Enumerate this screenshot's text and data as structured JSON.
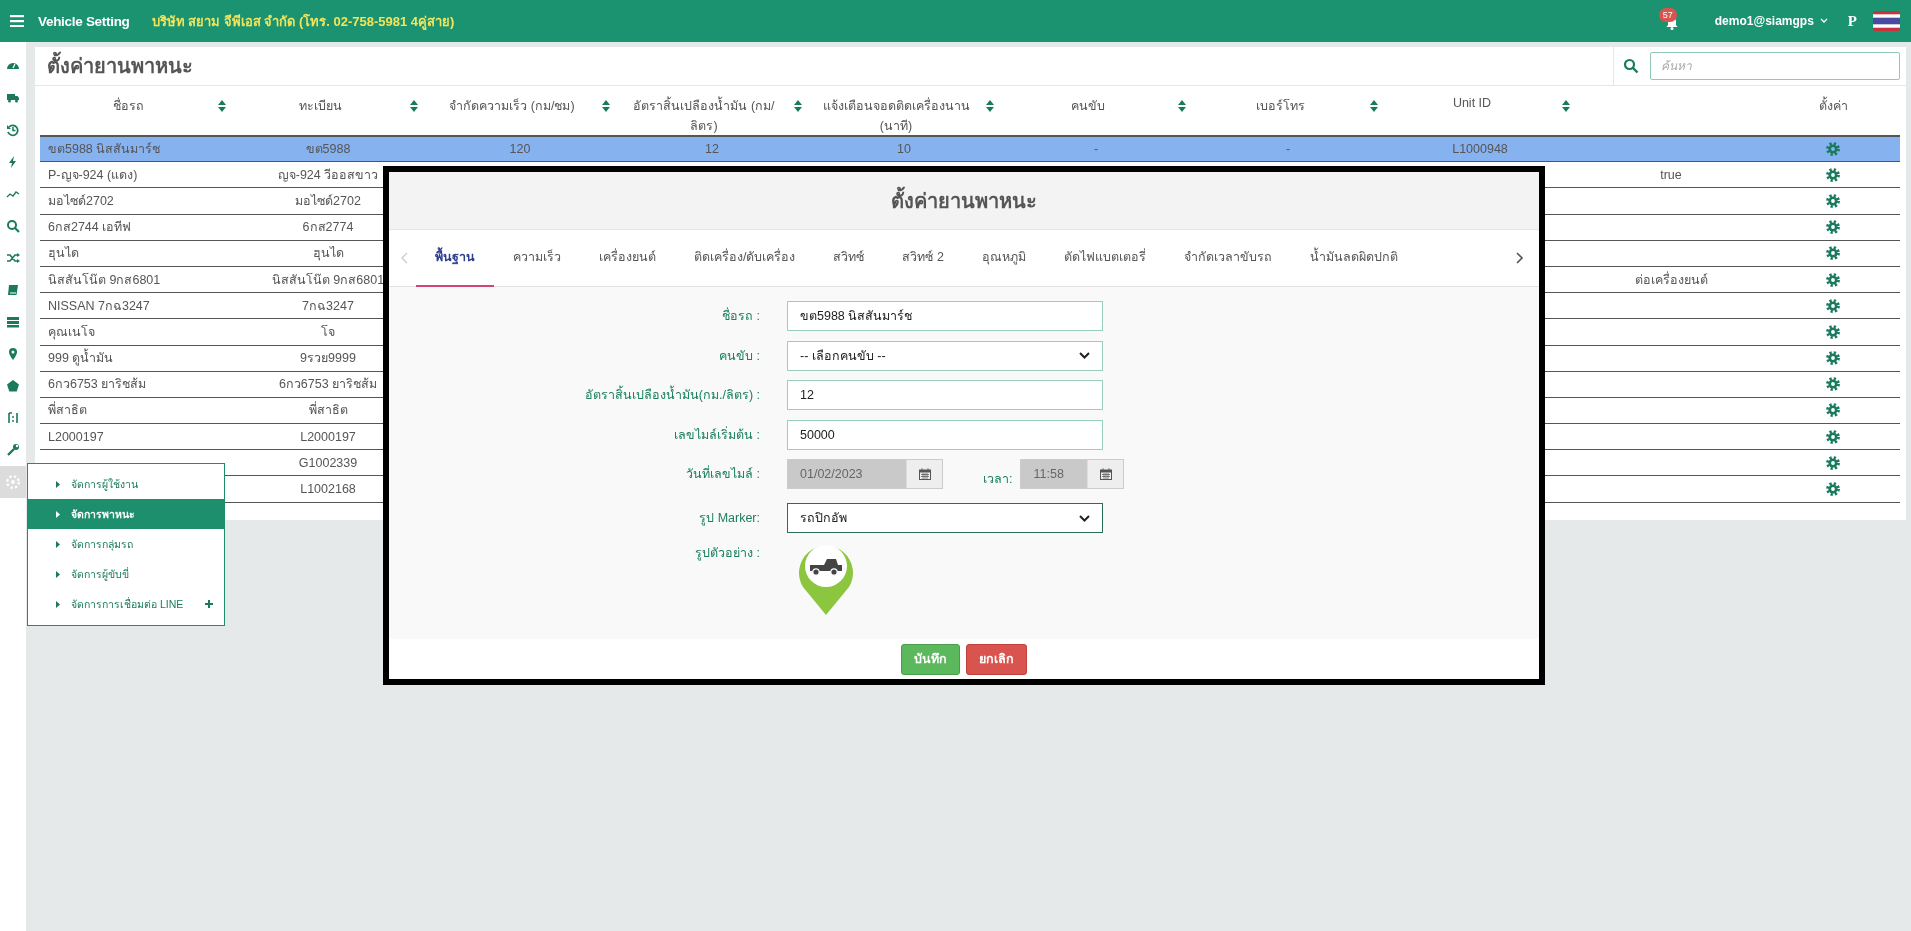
{
  "topbar": {
    "title": "Vehicle Setting",
    "company": "บริษัท สยาม จีพีเอส จำกัด (โทร. 02-758-5981 4คู่สาย)",
    "notification_count": "57",
    "user": "demo1@siamgps",
    "user_initial": "P"
  },
  "sidebar": {
    "items": [
      {
        "selected": false
      },
      {
        "selected": false
      },
      {
        "selected": false
      },
      {
        "selected": false
      },
      {
        "selected": false
      },
      {
        "selected": false
      },
      {
        "selected": false
      },
      {
        "selected": false
      },
      {
        "selected": false
      },
      {
        "selected": false
      },
      {
        "selected": false
      },
      {
        "selected": false
      },
      {
        "selected": false
      },
      {
        "selected": true
      }
    ]
  },
  "panel": {
    "title": "ตั้งค่ายานพาหนะ",
    "search": {
      "placeholder": "ค้นหา"
    }
  },
  "table": {
    "columns": [
      {
        "label": "ชื่อรถ",
        "sortable": true
      },
      {
        "label": "ทะเบียน",
        "sortable": true
      },
      {
        "label": "จำกัดความเร็ว (กม/ชม)",
        "sortable": true
      },
      {
        "label": "อัตราสิ้นเปลืองน้ำมัน (กม/ลิตร)",
        "sortable": true
      },
      {
        "label": "แจ้งเตือนจอดติดเครื่องนาน (นาที)",
        "sortable": true
      },
      {
        "label": "คนขับ",
        "sortable": true
      },
      {
        "label": "เบอร์โทร",
        "sortable": true
      },
      {
        "label": "Unit ID",
        "sortable": true
      },
      {
        "sortable": false
      },
      {
        "label": "ตั้งค่า",
        "sortable": false
      }
    ],
    "rows": [
      {
        "selected": true,
        "name": "ขต5988 นิสสันมาร์ช",
        "plate": "ขต5988",
        "speed_limit": "120",
        "fuel_rate": "12",
        "idle_alert": "10",
        "driver": "-",
        "phone": "-",
        "unit_id": "L1000948"
      },
      {
        "selected": false,
        "name": "P-ญจ-924 (แดง)",
        "plate": "ญจ-924 วีออสขาว",
        "column_9": "true"
      },
      {
        "selected": false,
        "name": "มอไซด์2702",
        "plate": "มอไซด์2702"
      },
      {
        "selected": false,
        "name": "6กส2744 เอทีฟ",
        "plate": "6กส2774"
      },
      {
        "selected": false,
        "name": "ฮุนได",
        "plate": "ฮุนได"
      },
      {
        "selected": false,
        "name": "นิสสันโน๊ต 9กส6801",
        "plate": "นิสสันโน๊ต 9กส6801",
        "column_9": "ต่อเครื่องยนต์"
      },
      {
        "selected": false,
        "name": "NISSAN 7กฉ3247",
        "plate": "7กฉ3247"
      },
      {
        "selected": false,
        "name": "คุณเนโจ",
        "plate": "โจ"
      },
      {
        "selected": false,
        "name": "999 ดูน้ำมัน",
        "plate": "9รวย9999"
      },
      {
        "selected": false,
        "name": "6กว6753 ยาริชส้ม",
        "plate": "6กว6753 ยาริชส้ม"
      },
      {
        "selected": false,
        "name": "พี่สาธิต",
        "plate": "พี่สาธิต"
      },
      {
        "selected": false,
        "name": "L2000197",
        "plate": "L2000197"
      },
      {
        "selected": false,
        "plate": "G1002339"
      },
      {
        "selected": false,
        "plate": "L1002168"
      }
    ]
  },
  "menu": {
    "items": [
      {
        "label": "จัดการผู้ใช้งาน",
        "selected": false,
        "addable": false
      },
      {
        "label": "จัดการพาหนะ",
        "selected": true,
        "addable": false
      },
      {
        "label": "จัดการกลุ่มรถ",
        "selected": false,
        "addable": false
      },
      {
        "label": "จัดการผู้ขับขี่",
        "selected": false,
        "addable": false
      },
      {
        "label": "จัดการการเชื่อมต่อ LINE",
        "selected": false,
        "addable": true
      }
    ]
  },
  "modal": {
    "title": "ตั้งค่ายานพาหนะ",
    "tabs": [
      {
        "label": "พื้นฐาน",
        "selected": true
      },
      {
        "label": "ความเร็ว",
        "selected": false
      },
      {
        "label": "เครื่องยนต์",
        "selected": false
      },
      {
        "label": "ติดเครื่อง/ดับเครื่อง",
        "selected": false
      },
      {
        "label": "สวิทซ์",
        "selected": false
      },
      {
        "label": "สวิทซ์ 2",
        "selected": false
      },
      {
        "label": "อุณหภูมิ",
        "selected": false
      },
      {
        "label": "ตัดไฟแบตเตอรี่",
        "selected": false
      },
      {
        "label": "จำกัดเวลาขับรถ",
        "selected": false
      },
      {
        "label": "น้ำมันลดผิดปกติ",
        "selected": false
      }
    ],
    "fields": [
      {
        "kind": "text",
        "label": "ชื่อรถ :",
        "value": "ขต5988 นิสสันมาร์ช"
      },
      {
        "kind": "select",
        "label": "คนขับ :",
        "value": "-- เลือกคนขับ --"
      },
      {
        "kind": "text",
        "label": "อัตราสิ้นเปลืองน้ำมัน(กม./ลิตร) :",
        "value": "12"
      },
      {
        "kind": "text",
        "label": "เลขไมล์เริ่มต้น :",
        "value": "50000"
      },
      {
        "kind": "datetime",
        "label": "วันที่เลขไมล์ :",
        "date": "01/02/2023",
        "time_label": "เวลา:",
        "time": "11:58",
        "disabled": true
      },
      {
        "kind": "select",
        "label": "รูป Marker:",
        "value": "รถปิกอัพ"
      },
      {
        "kind": "preview",
        "label": "รูปตัวอย่าง :"
      }
    ],
    "buttons": [
      {
        "kind": "save",
        "label": "บันทึก"
      },
      {
        "kind": "cancel",
        "label": "ยกเลิก"
      }
    ]
  }
}
